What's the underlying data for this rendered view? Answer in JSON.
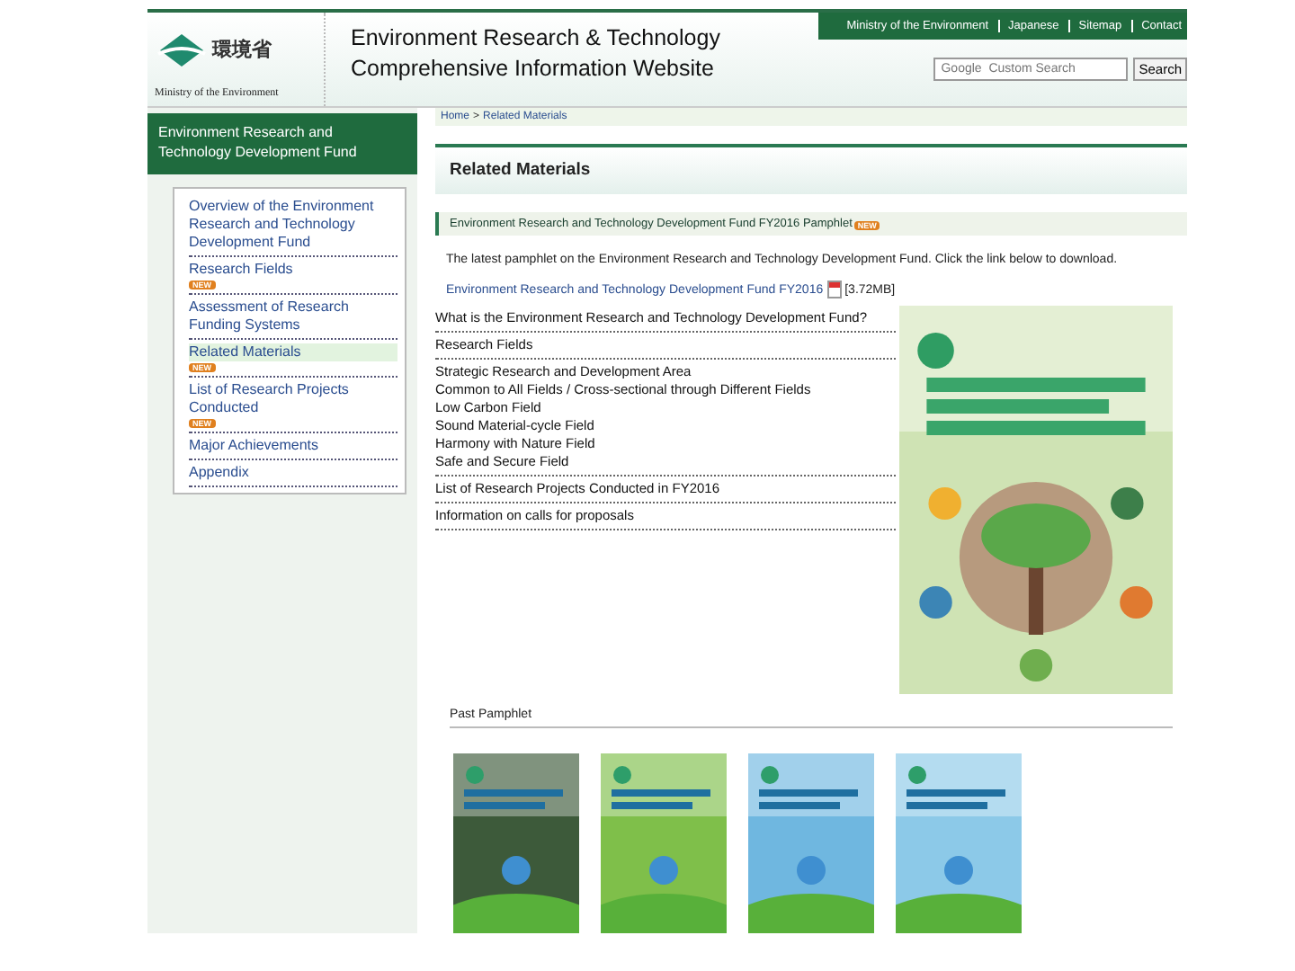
{
  "header": {
    "logo_name": "環境省",
    "logo_caption": "Ministry of the Environment",
    "title_lines": [
      "Environment Research & Technology",
      "Comprehensive Information Website"
    ],
    "nav": [
      "Ministry of the Environment",
      "Japanese",
      "Sitemap",
      "Contact"
    ],
    "search": {
      "placeholder": "Google  Custom Search",
      "button": "Search"
    }
  },
  "sidebar": {
    "title": "Environment Research and Technology Development Fund",
    "items": [
      {
        "label": "Overview of the Environment Research and Technology Development Fund",
        "selected": false
      },
      {
        "label": "Research Fields",
        "badge": "NEW",
        "selected": false
      },
      {
        "label": "Assessment of Research Funding Systems",
        "selected": false
      },
      {
        "label": "Related Materials",
        "badge": "NEW",
        "selected": true
      },
      {
        "label": "List of Research Projects Conducted",
        "badge": "NEW",
        "selected": false
      },
      {
        "label": "Major Achievements",
        "selected": false
      },
      {
        "label": "Appendix",
        "selected": false
      }
    ]
  },
  "breadcrumb": {
    "items": [
      "Home",
      "Related Materials"
    ],
    "separator": ">"
  },
  "page_title": "Related Materials",
  "section": {
    "title": "Environment Research and Technology Development Fund FY2016 Pamphlet",
    "badge": "NEW",
    "text": "The latest pamphlet on the Environment Research and Technology Development Fund. Click the link below to download.",
    "link": "Environment Research and Technology Development Fund FY2016",
    "size": "[3.72MB]"
  },
  "contents": [
    {
      "label": "What is the Environment Research and Technology Development Fund?"
    },
    {
      "label": "Research Fields"
    },
    {
      "label": "Strategic Research and Development Area",
      "children": [
        {
          "label": "Common to All Fields / Cross-sectional through Different Fields"
        },
        {
          "label": "Low Carbon Field"
        },
        {
          "label": "Sound Material-cycle Field"
        },
        {
          "label": "Harmony with Nature Field"
        },
        {
          "label": "Safe and Secure Field"
        }
      ]
    },
    {
      "label": "List of Research Projects Conducted in FY2016"
    },
    {
      "label": "Information on calls for proposals"
    }
  ],
  "past": {
    "title": "Past Pamphlet"
  }
}
